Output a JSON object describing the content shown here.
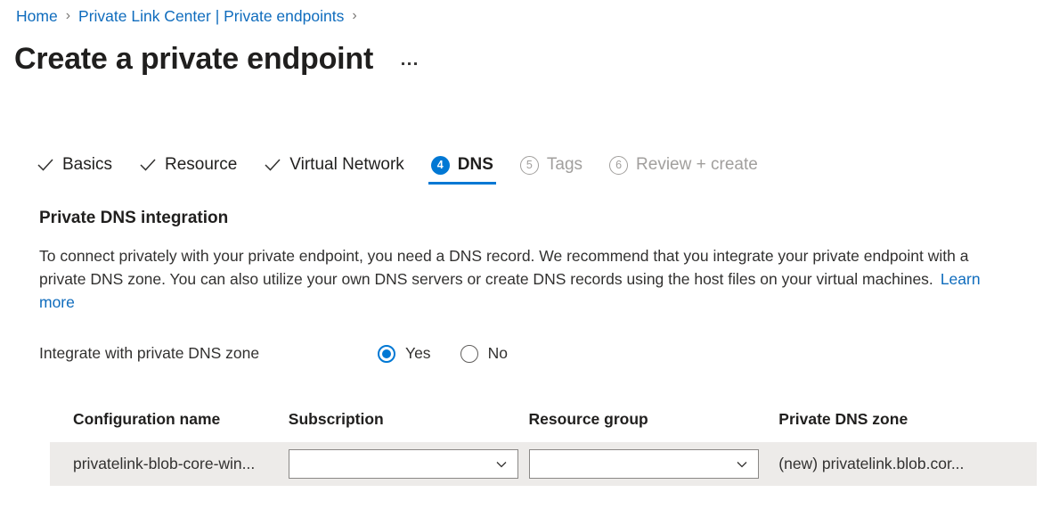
{
  "breadcrumb": {
    "items": [
      {
        "label": "Home",
        "separator": "›"
      },
      {
        "label": "Private Link Center | Private endpoints",
        "separator": "›"
      }
    ]
  },
  "header": {
    "title": "Create a private endpoint",
    "more_menu": "more-commands"
  },
  "wizard": {
    "tabs": [
      {
        "label": "Basics",
        "state": "completed",
        "marker": "check"
      },
      {
        "label": "Resource",
        "state": "completed",
        "marker": "check"
      },
      {
        "label": "Virtual Network",
        "state": "completed",
        "marker": "check"
      },
      {
        "label": "DNS",
        "state": "active",
        "marker": "4"
      },
      {
        "label": "Tags",
        "state": "upcoming",
        "marker": "5"
      },
      {
        "label": "Review + create",
        "state": "upcoming",
        "marker": "6"
      }
    ]
  },
  "section": {
    "heading": "Private DNS integration",
    "description": "To connect privately with your private endpoint, you need a DNS record. We recommend that you integrate your private endpoint with a private DNS zone. You can also utilize your own DNS servers or create DNS records using the host files on your virtual machines.",
    "learn_more": "Learn more"
  },
  "integrate_field": {
    "label": "Integrate with private DNS zone",
    "selected": "Yes",
    "options": [
      {
        "label": "Yes",
        "selected": true
      },
      {
        "label": "No",
        "selected": false
      }
    ]
  },
  "table": {
    "columns": [
      "Configuration name",
      "Subscription",
      "Resource group",
      "Private DNS zone"
    ],
    "rows": [
      {
        "configuration_name": "privatelink-blob-core-win...",
        "subscription": "",
        "subscription_placeholder": "",
        "resource_group": "",
        "resource_group_placeholder": "",
        "private_dns_zone": "(new) privatelink.blob.cor..."
      }
    ]
  },
  "colors": {
    "accent": "#0078d4",
    "link": "#0f6cbd",
    "text": "#323130",
    "disabled": "#a19f9d",
    "row_background": "#edebe9"
  }
}
